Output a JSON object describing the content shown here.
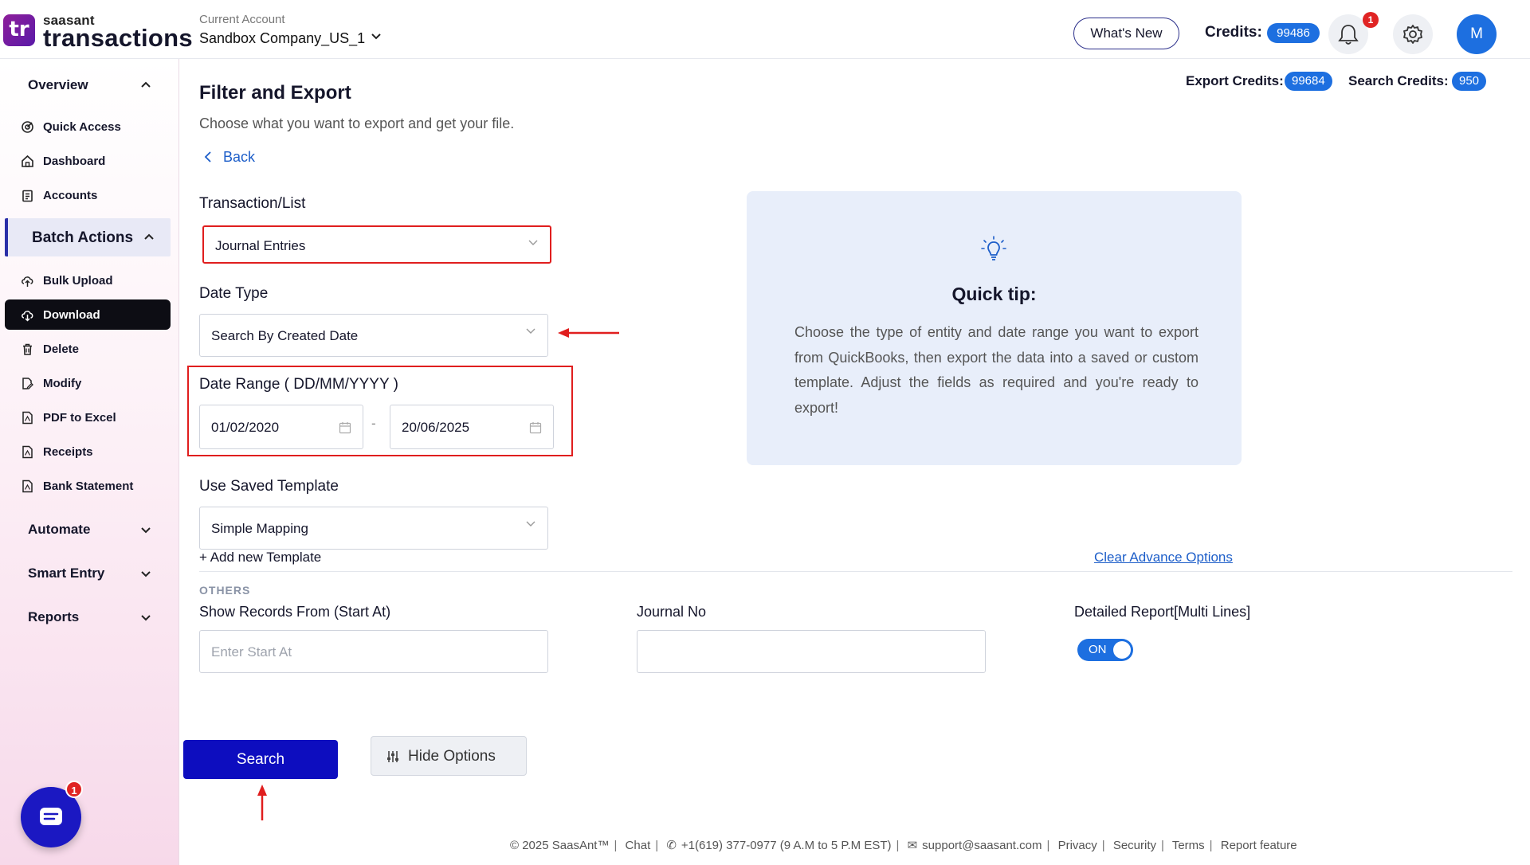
{
  "app": {
    "logo_mark": "tr",
    "logo_small": "saasant",
    "logo_big": "transactions"
  },
  "header": {
    "account_label": "Current Account",
    "account_name": "Sandbox Company_US_1",
    "whats_new": "What's New",
    "credits_label": "Credits:",
    "credits_value": "99486",
    "notification_count": "1",
    "avatar_initial": "M"
  },
  "sidebar": {
    "overview": "Overview",
    "quick_access": "Quick Access",
    "dashboard": "Dashboard",
    "accounts": "Accounts",
    "batch_actions": "Batch Actions",
    "bulk_upload": "Bulk Upload",
    "download": "Download",
    "delete": "Delete",
    "modify": "Modify",
    "pdf_to_excel": "PDF to Excel",
    "receipts": "Receipts",
    "bank_statement": "Bank Statement",
    "automate": "Automate",
    "smart_entry": "Smart Entry",
    "reports": "Reports",
    "chat_badge": "1"
  },
  "main": {
    "title": "Filter and Export",
    "subtitle": "Choose what you want to export and get your file.",
    "back": "Back",
    "export_credits_label": "Export Credits:",
    "export_credits_value": "99684",
    "search_credits_label": "Search Credits:",
    "search_credits_value": "950",
    "transaction_label": "Transaction/List",
    "transaction_value": "Journal Entries",
    "date_type_label": "Date Type",
    "date_type_value": "Search By Created Date",
    "date_range_label": "Date Range ( DD/MM/YYYY )",
    "date_from": "01/02/2020",
    "date_to": "20/06/2025",
    "date_sep": "-",
    "template_label": "Use Saved Template",
    "template_value": "Simple Mapping",
    "add_template": "+ Add new Template",
    "clear_options": "Clear Advance Options",
    "others_tag": "OTHERS",
    "show_records_label": "Show Records From (Start At)",
    "show_records_placeholder": "Enter Start At",
    "journal_no_label": "Journal No",
    "journal_no_value": "",
    "detailed_report_label": "Detailed Report[Multi Lines]",
    "toggle_state": "ON",
    "search_button": "Search",
    "hide_options_button": "Hide Options"
  },
  "tip": {
    "title": "Quick tip:",
    "body": "Choose the type of entity and date range you want to export from QuickBooks, then export the data into a saved or custom template. Adjust the fields as required and you're ready to export!"
  },
  "footer": {
    "copyright": "© 2025 SaasAnt™",
    "chat": "Chat",
    "phone": "+1(619) 377-0977 (9 A.M to 5 P.M EST)",
    "email": "support@saasant.com",
    "privacy": "Privacy",
    "security": "Security",
    "terms": "Terms",
    "report_feature": "Report feature"
  },
  "colors": {
    "brand_primary": "#0d0dbf",
    "accent_blue": "#1d6fe0",
    "annotation_red": "#e01e1e"
  }
}
